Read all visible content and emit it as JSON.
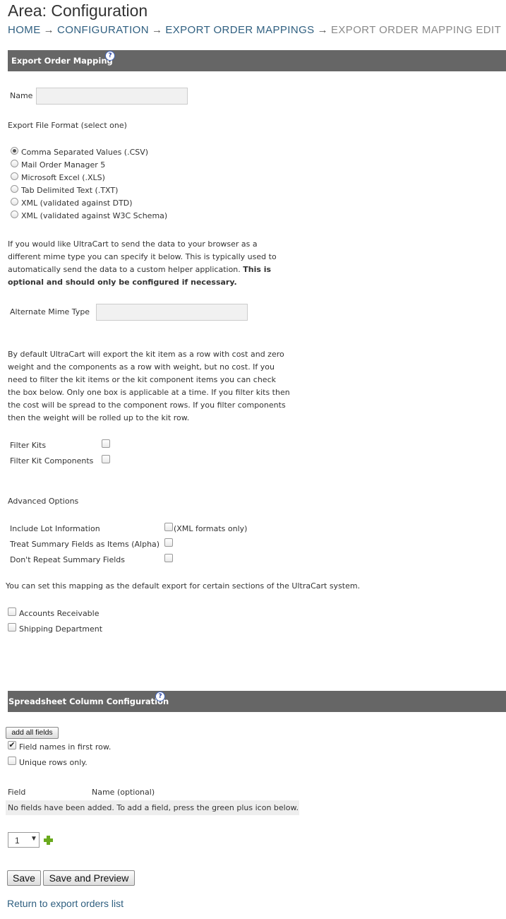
{
  "header": {
    "title": "Area: Configuration",
    "breadcrumbs": [
      {
        "label": "HOME"
      },
      {
        "label": "CONFIGURATION"
      },
      {
        "label": "EXPORT ORDER MAPPINGS"
      },
      {
        "label": "EXPORT ORDER MAPPING EDIT"
      }
    ],
    "arrow": "→"
  },
  "mapping_section": {
    "title": "Export Order Mapping",
    "help": "?",
    "name_label": "Name",
    "name_value": "",
    "format_heading": "Export File Format (select one)",
    "formats": [
      {
        "label": "Comma Separated Values (.CSV)",
        "checked": true
      },
      {
        "label": "Mail Order Manager 5",
        "checked": false
      },
      {
        "label": "Microsoft Excel (.XLS)",
        "checked": false
      },
      {
        "label": "Tab Delimited Text (.TXT)",
        "checked": false
      },
      {
        "label": "XML (validated against DTD)",
        "checked": false
      },
      {
        "label": "XML (validated against W3C Schema)",
        "checked": false
      }
    ],
    "mime_text": "If you would like UltraCart to send the data to your browser as a different mime type you can specify it below. This is typically used to automatically send the data to a custom helper application. ",
    "mime_text_bold": "This is optional and should only be configured if necessary.",
    "mime_label": "Alternate Mime Type",
    "mime_value": "",
    "kit_text": "By default UltraCart will export the kit item as a row with cost and zero weight and the components as a row with weight, but no cost. If you need to filter the kit items or the kit component items you can check the box below. Only one box is applicable at a time. If you filter kits then the cost will be spread to the component rows. If you filter components then the weight will be rolled up to the kit row.",
    "filter_kits_label": "Filter Kits",
    "filter_components_label": "Filter Kit Components",
    "advanced_heading": "Advanced Options",
    "advanced": [
      {
        "label": "Include Lot Information",
        "note": "(XML formats only)",
        "checked": false
      },
      {
        "label": "Treat Summary Fields as Items (Alpha)",
        "note": "",
        "checked": false
      },
      {
        "label": "Don't Repeat Summary Fields",
        "note": "",
        "checked": false
      }
    ],
    "default_text": "You can set this mapping as the default export for certain sections of the UltraCart system.",
    "defaults": [
      {
        "label": "Accounts Receivable",
        "checked": false
      },
      {
        "label": "Shipping Department",
        "checked": false
      }
    ]
  },
  "spreadsheet_section": {
    "title": "Spreadsheet Column Configuration",
    "help": "?",
    "add_all_label": "add all fields",
    "field_names_label": "Field names in first row.",
    "field_names_checked": true,
    "unique_rows_label": "Unique rows only.",
    "unique_rows_checked": false,
    "col_field": "Field",
    "col_name": "Name (optional)",
    "empty_message": "No fields have been added. To add a field, press the green plus icon below.",
    "count_select_value": "1"
  },
  "actions": {
    "save_label": "Save",
    "save_preview_label": "Save and Preview",
    "return_link": "Return to export orders list"
  },
  "colors": {
    "section_bar": "#666666",
    "link": "#2f5f80",
    "plus_icon": "#6aaa1e"
  },
  "icons": {
    "help": "help-icon",
    "plus": "plus-icon",
    "dropdown": "chevron-down-icon"
  }
}
